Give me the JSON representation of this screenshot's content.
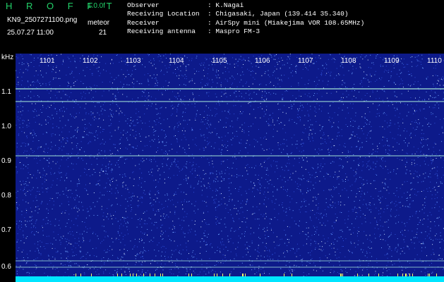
{
  "header": {
    "app_title": "H R O F F T",
    "version": "1.0.0f",
    "filename": "KN9_2507271100.png",
    "mode": "meteor",
    "datetime": "25.07.27 11:00",
    "count": "21"
  },
  "info": [
    {
      "key": "Observer",
      "value": ": K.Nagai"
    },
    {
      "key": "Receiving Location",
      "value": ": Chigasaki, Japan (139.414 35.340)"
    },
    {
      "key": "Receiver",
      "value": ": AirSpy mini (Miakejima VOR 108.65MHz)"
    },
    {
      "key": "Receiving antenna",
      "value": ": Maspro FM-3"
    }
  ],
  "spectrogram": {
    "unit": "kHz",
    "y_ticks": [
      "1.1",
      "1.0",
      "0.9",
      "0.8",
      "0.7",
      "0.6"
    ],
    "x_ticks": [
      "1101",
      "1102",
      "1103",
      "1104",
      "1105",
      "1106",
      "1107",
      "1108",
      "1109",
      "1110"
    ],
    "colors": {
      "background": "#0d1a8a",
      "noise": "#6aa0ff",
      "line": "#b8ffe0",
      "bottom_band": "#00e5ff"
    }
  }
}
